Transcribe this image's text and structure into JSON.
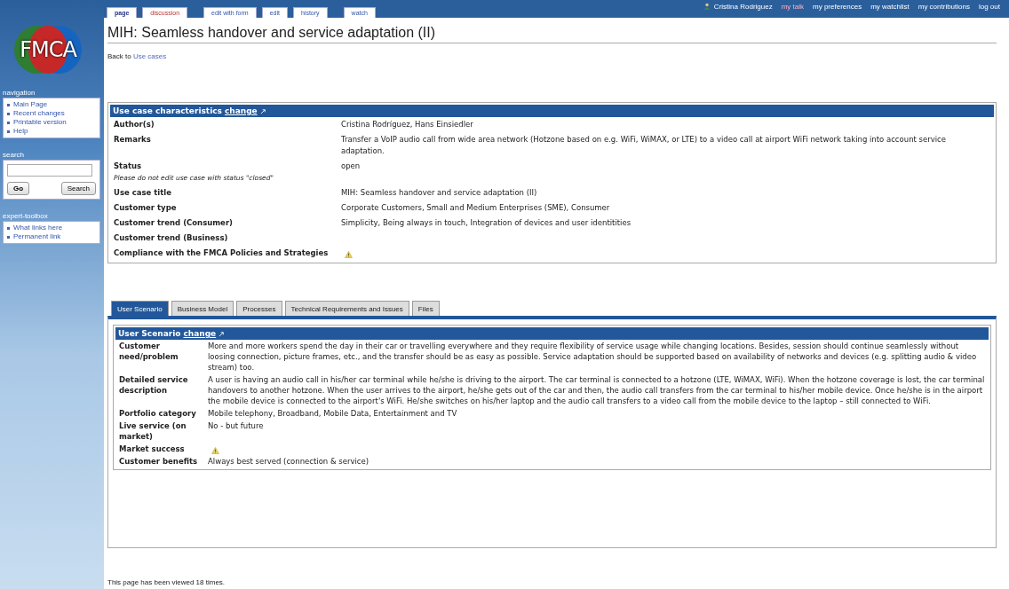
{
  "logo": "FMCA",
  "page_tabs": [
    {
      "label": "page",
      "selected": true,
      "kind": "normal"
    },
    {
      "label": "discussion",
      "selected": false,
      "kind": "new"
    },
    {
      "label": "edit with form",
      "selected": false,
      "kind": "normal"
    },
    {
      "label": "edit",
      "selected": false,
      "kind": "normal"
    },
    {
      "label": "history",
      "selected": false,
      "kind": "normal"
    },
    {
      "label": "watch",
      "selected": false,
      "kind": "normal"
    }
  ],
  "user_links": [
    {
      "label": "Cristina Rodriguez",
      "kind": "user"
    },
    {
      "label": "my talk",
      "kind": "new"
    },
    {
      "label": "my preferences",
      "kind": "normal"
    },
    {
      "label": "my watchlist",
      "kind": "normal"
    },
    {
      "label": "my contributions",
      "kind": "normal"
    },
    {
      "label": "log out",
      "kind": "normal"
    }
  ],
  "sidebar": {
    "navigation": {
      "title": "navigation",
      "items": [
        "Main Page",
        "Recent changes",
        "Printable version",
        "Help"
      ]
    },
    "search": {
      "title": "search",
      "buttons": [
        "Go",
        "Search"
      ]
    },
    "toolbox": {
      "title": "expert-toolbox",
      "items": [
        "What links here",
        "Permanent link"
      ]
    }
  },
  "title": "MIH: Seamless handover and service adaptation (II)",
  "back": {
    "prefix": "Back to",
    "link": "Use cases"
  },
  "characteristics": {
    "title": "Use case characteristics",
    "change": "change",
    "rows": [
      {
        "label": "Author(s)",
        "value": "Cristina Rodríguez, Hans Einsiedler"
      },
      {
        "label": "Remarks",
        "value": "Transfer a VoIP audio call from wide area network (Hotzone based on e.g. WiFi, WiMAX, or LTE) to a video call at airport WiFi network taking into account service adaptation."
      },
      {
        "label": "Status",
        "note": "Please do not edit use case with status \"closed\"",
        "value": "open"
      },
      {
        "label": "Use case title",
        "value": "MIH: Seamless handover and service adaptation (II)"
      },
      {
        "label": "Customer type",
        "value": "Corporate Customers, Small and Medium Enterprises (SME), Consumer"
      },
      {
        "label": "Customer trend (Consumer)",
        "value": "Simplicity, Being always in touch, Integration of devices and user identitities"
      },
      {
        "label": "Customer trend (Business)"
      },
      {
        "label": "Compliance with the FMCA Policies and Strategies",
        "kind": "warning"
      }
    ]
  },
  "tabs": [
    {
      "label": "User Scenario",
      "selected": true
    },
    {
      "label": "Business Model",
      "selected": false
    },
    {
      "label": "Processes",
      "selected": false
    },
    {
      "label": "Technical Requirements and Issues",
      "selected": false
    },
    {
      "label": "Files",
      "selected": false
    }
  ],
  "scenario": {
    "title": "User Scenario",
    "change": "change",
    "rows": [
      {
        "label": "Customer need/problem",
        "value": "More and more workers spend the day in their car or travelling everywhere and they require flexibility of service usage while changing locations. Besides, session should continue seamlessly without loosing connection, picture frames, etc., and the transfer should be as easy as possible. Service adaptation should be supported based on availability of networks and devices (e.g. splitting audio & video stream) too."
      },
      {
        "label": "Detailed service description",
        "value": "A user is having an audio call in his/her car terminal while he/she is driving to the airport. The car terminal is connected to a hotzone (LTE, WiMAX, WiFi). When the hotzone coverage is lost, the car terminal handovers to another hotzone. When the user arrives to the airport, he/she gets out of the car and then, the audio call transfers from the car terminal to his/her mobile device. Once he/she is in the airport the mobile device is connected to the airport's WiFi. He/she switches on his/her laptop and the audio call transfers to a video call from the mobile device to the laptop – still connected to WiFi."
      },
      {
        "label": "Portfolio category",
        "value": "Mobile telephony, Broadband, Mobile Data, Entertainment and TV"
      },
      {
        "label": "Live service (on market)",
        "value": "No - but future"
      },
      {
        "label": "Market success",
        "kind": "warning"
      },
      {
        "label": "Customer benefits",
        "value": "Always best served (connection & service)"
      }
    ]
  },
  "footer": "This page has been viewed 18 times."
}
